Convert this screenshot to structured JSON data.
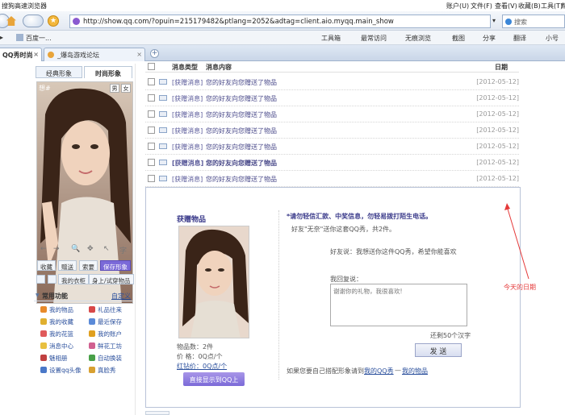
{
  "browser": {
    "title": "搜狗高速浏览器",
    "menus": [
      "账户(U)",
      "文件(F)",
      "查看(V)",
      "收藏(B)",
      "工具(T)",
      "帮"
    ],
    "address": "http://show.qq.com/?opuin=215179482&ptlang=2052&adtag=client.aio.myqq.main_show",
    "search_placeholder": "搜索",
    "bookmark": "百度一...",
    "toolbar_items": [
      "工具箱",
      "最常访问",
      "无痕浏览",
      "截图",
      "分享",
      "翻译",
      "小号"
    ],
    "tabs": [
      "QQ秀时尚",
      "_爆岛游戏论坛"
    ]
  },
  "sidebar": {
    "tabs": [
      "经典形象",
      "时尚形象"
    ],
    "header_text": "想#",
    "gender": [
      "男",
      "女"
    ],
    "photo_tools": [
      "←",
      "→",
      "🔍",
      "✥",
      "↖",
      "字"
    ],
    "action_buttons": [
      "收藏",
      "赠送",
      "索要",
      "保存形象"
    ],
    "wardrobe": [
      "我的衣柜",
      "身上/试穿物品"
    ],
    "func_title": "常用功能",
    "func_custom": "自定义",
    "links": [
      {
        "label": "我的物品",
        "color": "#e88a2a"
      },
      {
        "label": "礼品往来",
        "color": "#d84848"
      },
      {
        "label": "我的收藏",
        "color": "#e0b030"
      },
      {
        "label": "最近保存",
        "color": "#5a8ad8"
      },
      {
        "label": "我的花篮",
        "color": "#e05a5a"
      },
      {
        "label": "我的账户",
        "color": "#e0a020"
      },
      {
        "label": "消息中心",
        "color": "#e8c040"
      },
      {
        "label": "鲜花工坊",
        "color": "#d06090"
      },
      {
        "label": "魅相册",
        "color": "#c04040"
      },
      {
        "label": "自动换装",
        "color": "#48a048"
      },
      {
        "label": "设置qq头像",
        "color": "#4a78c8"
      },
      {
        "label": "真脸秀",
        "color": "#d8a030"
      }
    ]
  },
  "list": {
    "headers": {
      "type": "消息类型",
      "content": "消息内容",
      "date": "日期"
    },
    "rows": [
      {
        "type": "[获赠消息]",
        "content": "您的好友向您赠送了物品",
        "date": "[2012-05-12]",
        "bold": false
      },
      {
        "type": "[获赠消息]",
        "content": "您的好友向您赠送了物品",
        "date": "[2012-05-12]",
        "bold": false
      },
      {
        "type": "[获赠消息]",
        "content": "您的好友向您赠送了物品",
        "date": "[2012-05-12]",
        "bold": false
      },
      {
        "type": "[获赠消息]",
        "content": "您的好友向您赠送了物品",
        "date": "[2012-05-12]",
        "bold": false
      },
      {
        "type": "[获赠消息]",
        "content": "您的好友向您赠送了物品",
        "date": "[2012-05-12]",
        "bold": false
      },
      {
        "type": "[获赠消息]",
        "content": "您的好友向您赠送了物品",
        "date": "[2012-05-12]",
        "bold": true
      },
      {
        "type": "[获赠消息]",
        "content": "您的好友向您赠送了物品",
        "date": "[2012-05-12]",
        "bold": false
      },
      {
        "type": "[获赠消息]",
        "content": "您的好友向您赠送了物品",
        "date": "[2012-05-12]",
        "bold": true
      }
    ]
  },
  "detail": {
    "title": "获赠物品",
    "item_count": "物品数：2件",
    "price": "价 格：0Q点/个",
    "red_price": "红钻价：0Q点/个",
    "show_button": "直接显示到QQ上",
    "warning": "*请勿轻信汇款、中奖信息，勿轻易拨打陌生电话。",
    "friend_line": "好友\"无奈\"送你这套QQ秀，共2件。",
    "friend_says": "好友说：我想送你这件QQ秀，希望你能喜欢",
    "reply_label": "我回复说：",
    "reply_placeholder": "谢谢你的礼物，我很喜欢!",
    "remaining": "还剩50个汉字",
    "send": "发 送",
    "footer_text": "如果您要自己搭配形象请到",
    "footer_links": [
      "我的QQ秀",
      "我的物品"
    ],
    "footer_sep": "—"
  },
  "annotation": "今天的日期"
}
